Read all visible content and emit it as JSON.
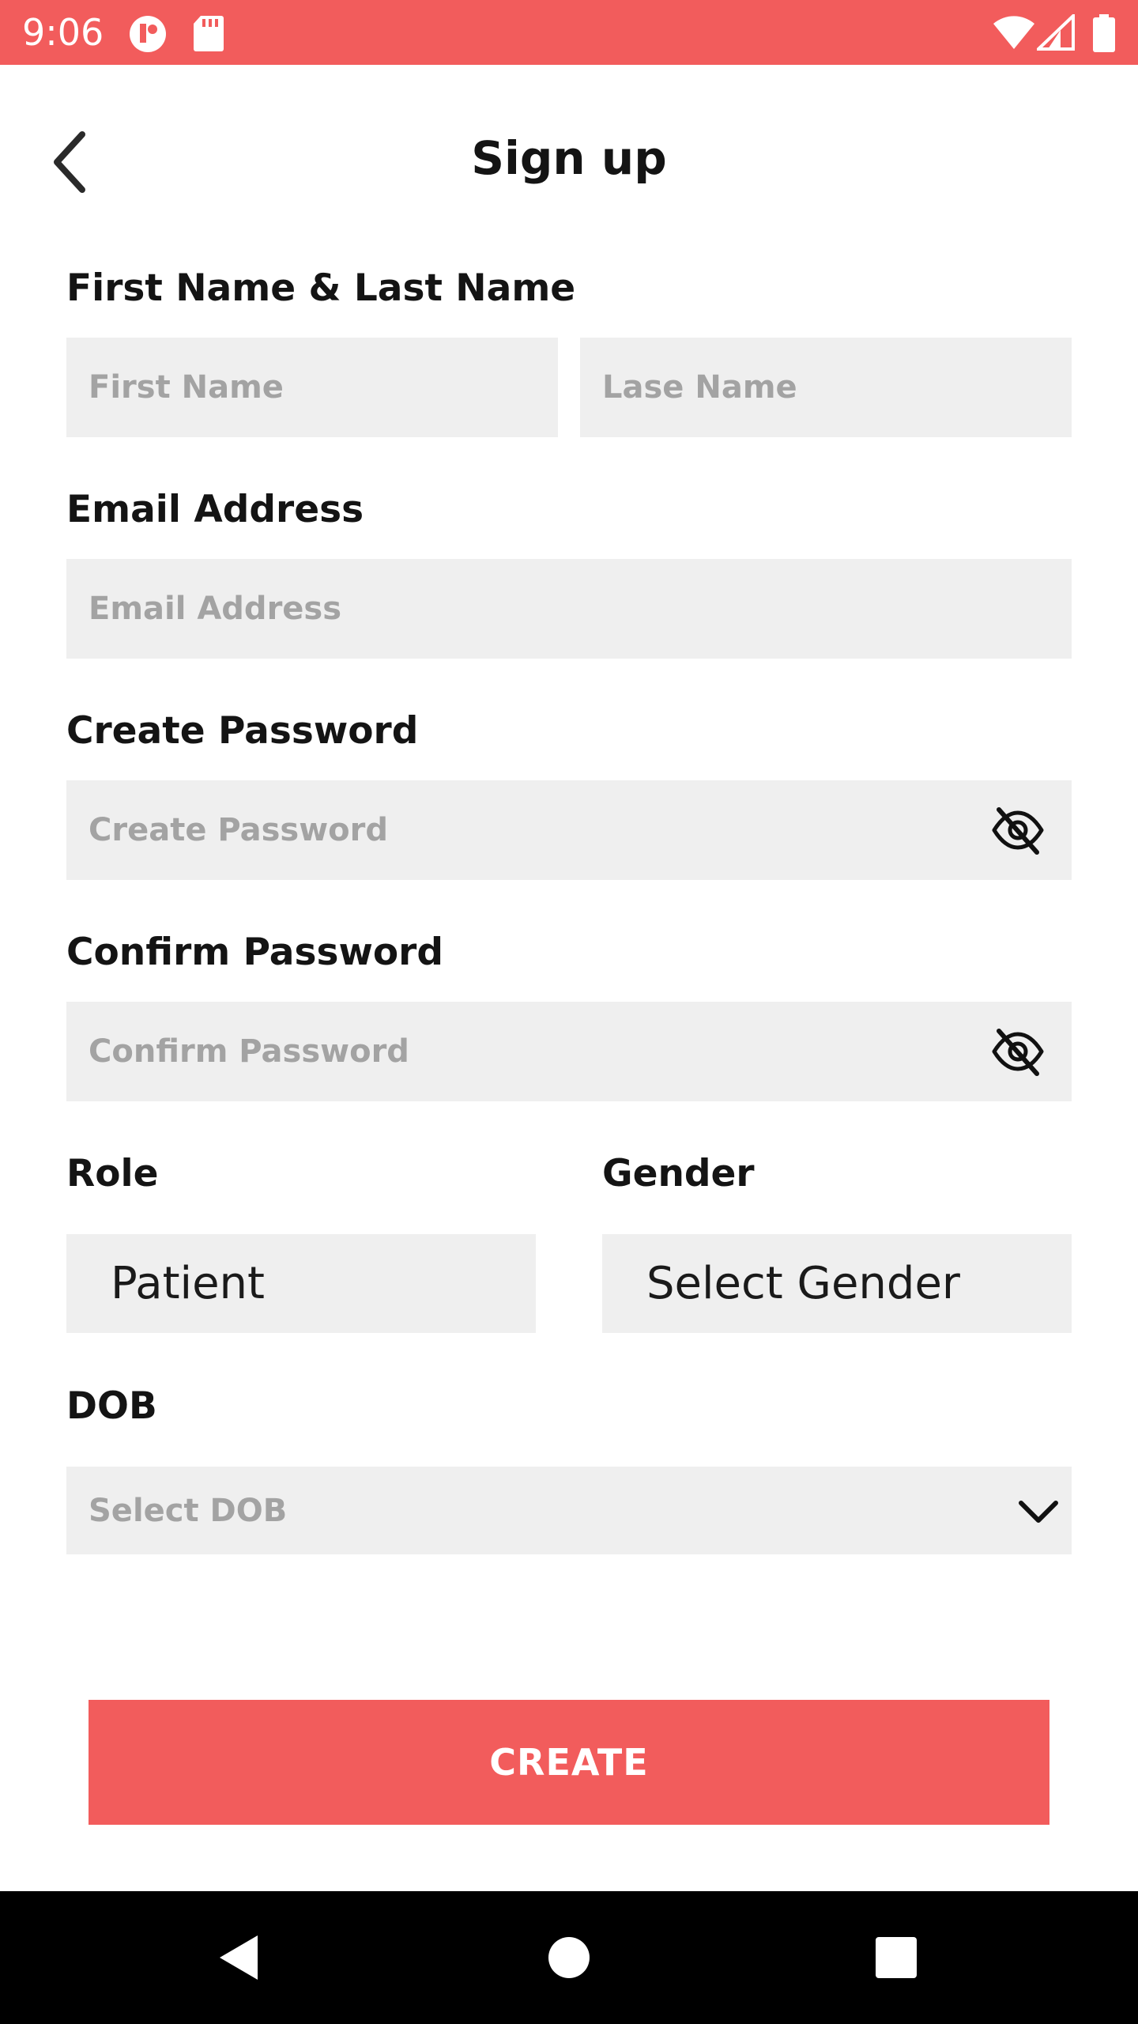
{
  "status_bar": {
    "time": "9:06",
    "background": "#f25c5c",
    "left_icons": [
      "profile-badge-icon",
      "sd-card-icon"
    ],
    "right_icons": [
      "wifi-icon",
      "signal-icon",
      "battery-icon"
    ]
  },
  "header": {
    "title": "Sign up",
    "back_icon": "chevron-left-icon"
  },
  "form": {
    "name": {
      "label": "First Name & Last Name",
      "first_placeholder": "First Name",
      "last_placeholder": "Lase Name",
      "first_value": "",
      "last_value": ""
    },
    "email": {
      "label": "Email Address",
      "placeholder": "Email Address",
      "value": ""
    },
    "create_password": {
      "label": "Create Password",
      "placeholder": "Create Password",
      "value": "",
      "toggle_icon": "eye-off-icon"
    },
    "confirm_password": {
      "label": "Confirm Password",
      "placeholder": "Confirm Password",
      "value": "",
      "toggle_icon": "eye-off-icon"
    },
    "role": {
      "label": "Role",
      "value": "Patient"
    },
    "gender": {
      "label": "Gender",
      "value": "Select Gender"
    },
    "dob": {
      "label": "DOB",
      "value": "Select DOB",
      "icon": "chevron-down-icon"
    }
  },
  "actions": {
    "create_label": "CREATE",
    "accent_color": "#f25c5c"
  },
  "nav_bar": {
    "buttons": [
      "back-triangle-icon",
      "home-circle-icon",
      "recents-square-icon"
    ]
  }
}
